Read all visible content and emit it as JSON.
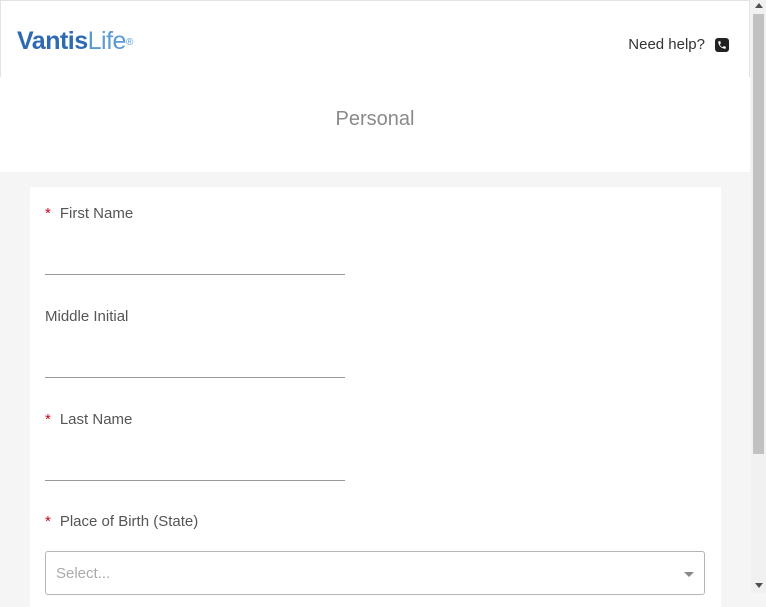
{
  "brand": {
    "name_bold": "Vantis",
    "name_light": "Life",
    "reg_mark": "®"
  },
  "header": {
    "help_text": "Need help?",
    "help_icon": "phone-icon"
  },
  "page": {
    "title": "Personal"
  },
  "form": {
    "required_marker": "*",
    "first_name": {
      "label": "First Name",
      "value": ""
    },
    "middle_initial": {
      "label": "Middle Initial",
      "value": ""
    },
    "last_name": {
      "label": "Last Name",
      "value": ""
    },
    "place_of_birth": {
      "label": "Place of Birth (State)",
      "placeholder": "Select..."
    }
  },
  "colors": {
    "brand": "#2e6ab3",
    "brand_light": "#5b9bd5",
    "required": "#d0021b",
    "background": "#f5f5f5"
  }
}
